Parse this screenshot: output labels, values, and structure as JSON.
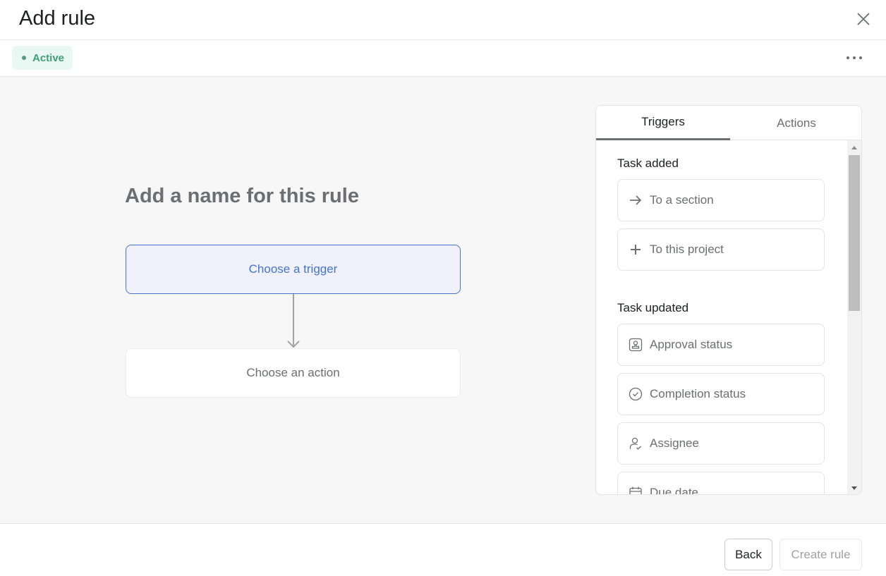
{
  "header": {
    "title": "Add rule",
    "close_icon": "close-icon"
  },
  "subbar": {
    "status_badge": "Active",
    "status_color": "#3f9f76",
    "more_icon": "more-horizontal-icon"
  },
  "main": {
    "rule_name_placeholder": "Add a name for this rule",
    "trigger_box": "Choose a trigger",
    "action_box": "Choose an action",
    "accent_color": "#4573d2"
  },
  "panel": {
    "tabs": [
      {
        "label": "Triggers",
        "active": true
      },
      {
        "label": "Actions",
        "active": false
      }
    ],
    "sections": [
      {
        "label": "Task added",
        "items": [
          {
            "label": "To a section",
            "icon": "arrow-right-icon"
          },
          {
            "label": "To this project",
            "icon": "plus-icon"
          }
        ]
      },
      {
        "label": "Task updated",
        "items": [
          {
            "label": "Approval status",
            "icon": "stamp-icon"
          },
          {
            "label": "Completion status",
            "icon": "check-circle-icon"
          },
          {
            "label": "Assignee",
            "icon": "user-check-icon"
          },
          {
            "label": "Due date",
            "icon": "calendar-icon"
          }
        ]
      }
    ]
  },
  "footer": {
    "back_label": "Back",
    "create_label": "Create rule",
    "create_disabled": true
  }
}
